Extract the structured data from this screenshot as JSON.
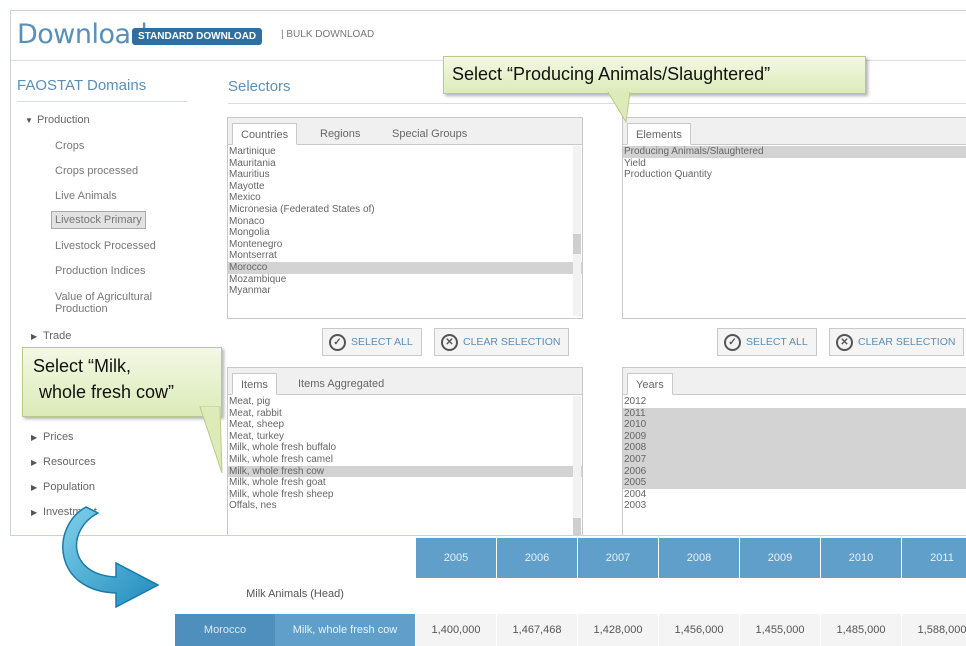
{
  "header": {
    "title": "Download",
    "standard_tab": "STANDARD DOWNLOAD",
    "bulk_tab": "| BULK DOWNLOAD"
  },
  "domains": {
    "title": "FAOSTAT Domains",
    "production": "Production",
    "production_items": [
      "Crops",
      "Crops processed",
      "Live Animals",
      "Livestock Primary",
      "Livestock Processed",
      "Production Indices",
      "Value of Agricultural Production"
    ],
    "selected_item": "Livestock Primary",
    "other": [
      "Trade",
      "Prices",
      "Resources",
      "Population",
      "Investment"
    ]
  },
  "selectors": {
    "title": "Selectors",
    "countries": {
      "tabs": [
        "Countries",
        "Regions",
        "Special Groups"
      ],
      "items": [
        "Martinique",
        "Mauritania",
        "Mauritius",
        "Mayotte",
        "Mexico",
        "Micronesia (Federated States of)",
        "Monaco",
        "Mongolia",
        "Montenegro",
        "Montserrat",
        "Morocco",
        "Mozambique",
        "Myanmar"
      ],
      "selected": [
        "Morocco"
      ]
    },
    "elements": {
      "tabs": [
        "Elements"
      ],
      "items": [
        "Producing Animals/Slaughtered",
        "Yield",
        "Production Quantity"
      ],
      "selected": [
        "Producing Animals/Slaughtered"
      ]
    },
    "items": {
      "tabs": [
        "Items",
        "Items Aggregated"
      ],
      "items": [
        "Meat, pig",
        "Meat, rabbit",
        "Meat, sheep",
        "Meat, turkey",
        "Milk, whole fresh buffalo",
        "Milk, whole fresh camel",
        "Milk, whole fresh cow",
        "Milk, whole fresh goat",
        "Milk, whole fresh sheep",
        "Offals, nes"
      ],
      "selected": [
        "Milk, whole fresh cow"
      ]
    },
    "years": {
      "tabs": [
        "Years"
      ],
      "items": [
        "2012",
        "2011",
        "2010",
        "2009",
        "2008",
        "2007",
        "2006",
        "2005",
        "2004",
        "2003"
      ],
      "selected": [
        "2011",
        "2010",
        "2009",
        "2008",
        "2007",
        "2006",
        "2005"
      ]
    },
    "select_all": "SELECT ALL",
    "clear_selection": "CLEAR SELECTION"
  },
  "callouts": {
    "elements_hint": "Select  “Producing Animals/Slaughtered”",
    "items_hint_line1": "Select  “Milk,",
    "items_hint_line2": "whole fresh cow”"
  },
  "result_table": {
    "years": [
      "2005",
      "2006",
      "2007",
      "2008",
      "2009",
      "2010",
      "2011"
    ],
    "element_label": "Milk Animals (Head)",
    "row": {
      "country": "Morocco",
      "item": "Milk, whole fresh cow",
      "values": [
        "1,400,000",
        "1,467,468",
        "1,428,000",
        "1,456,000",
        "1,455,000",
        "1,485,000",
        "1,588,000"
      ]
    }
  },
  "colors": {
    "accent": "#5a8fb8",
    "table_header": "#5f9fc9",
    "callout": "#dcebb8",
    "arrow": "#3aa0c8"
  }
}
